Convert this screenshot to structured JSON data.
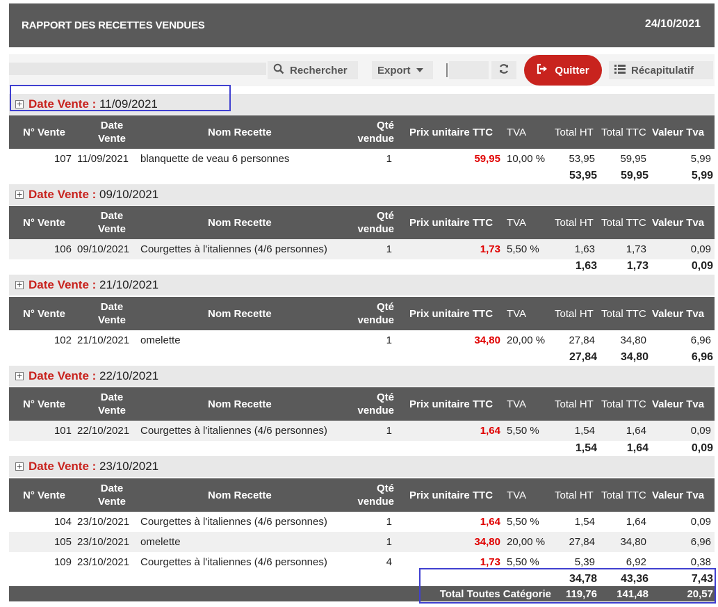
{
  "header": {
    "title": "RAPPORT DES RECETTES VENDUES",
    "date": "24/10/2021"
  },
  "toolbar": {
    "search_label": "Rechercher",
    "export_label": "Export",
    "quit_label": "Quitter",
    "summary_label": "Récapitulatif"
  },
  "icons": [
    "search-icon",
    "caret-down-icon",
    "refresh-icon",
    "sign-out-icon",
    "list-icon",
    "expand-icon"
  ],
  "colors": {
    "header_bg": "#5a5a5a",
    "accent": "#c8231e",
    "price": "#e00000",
    "highlight": "#4040d0"
  },
  "columns": [
    "N° Vente",
    "Date Vente",
    "Nom Recette",
    "Qté vendue",
    "Prix unitaire TTC",
    "TVA",
    "Total HT",
    "Total TTC",
    "Valeur Tva"
  ],
  "group_label": "Date Vente :",
  "groups": [
    {
      "date": "11/09/2021",
      "rows": [
        {
          "num": "107",
          "date": "11/09/2021",
          "name": "blanquette de veau 6 personnes",
          "qty": "1",
          "price": "59,95",
          "tva": "10,00 %",
          "ht": "53,95",
          "ttc": "59,95",
          "vtva": "5,99"
        }
      ],
      "total": {
        "ht": "53,95",
        "ttc": "59,95",
        "vtva": "5,99"
      }
    },
    {
      "date": "09/10/2021",
      "rows": [
        {
          "num": "106",
          "date": "09/10/2021",
          "name": "Courgettes à l'italiennes (4/6 personnes)",
          "qty": "1",
          "price": "1,73",
          "tva": "5,50 %",
          "ht": "1,63",
          "ttc": "1,73",
          "vtva": "0,09"
        }
      ],
      "total": {
        "ht": "1,63",
        "ttc": "1,73",
        "vtva": "0,09"
      }
    },
    {
      "date": "21/10/2021",
      "rows": [
        {
          "num": "102",
          "date": "21/10/2021",
          "name": "omelette",
          "qty": "1",
          "price": "34,80",
          "tva": "20,00 %",
          "ht": "27,84",
          "ttc": "34,80",
          "vtva": "6,96"
        }
      ],
      "total": {
        "ht": "27,84",
        "ttc": "34,80",
        "vtva": "6,96"
      }
    },
    {
      "date": "22/10/2021",
      "rows": [
        {
          "num": "101",
          "date": "22/10/2021",
          "name": "Courgettes à l'italiennes (4/6 personnes)",
          "qty": "1",
          "price": "1,64",
          "tva": "5,50 %",
          "ht": "1,54",
          "ttc": "1,64",
          "vtva": "0,09"
        }
      ],
      "total": {
        "ht": "1,54",
        "ttc": "1,64",
        "vtva": "0,09"
      }
    },
    {
      "date": "23/10/2021",
      "rows": [
        {
          "num": "104",
          "date": "23/10/2021",
          "name": "Courgettes à l'italiennes (4/6 personnes)",
          "qty": "1",
          "price": "1,64",
          "tva": "5,50 %",
          "ht": "1,54",
          "ttc": "1,64",
          "vtva": "0,09"
        },
        {
          "num": "105",
          "date": "23/10/2021",
          "name": "omelette",
          "qty": "1",
          "price": "34,80",
          "tva": "20,00 %",
          "ht": "27,84",
          "ttc": "34,80",
          "vtva": "6,96"
        },
        {
          "num": "109",
          "date": "23/10/2021",
          "name": "Courgettes à l'italiennes (4/6 personnes)",
          "qty": "4",
          "price": "1,73",
          "tva": "5,50 %",
          "ht": "5,39",
          "ttc": "6,92",
          "vtva": "0,38"
        }
      ],
      "total": {
        "ht": "34,78",
        "ttc": "43,36",
        "vtva": "7,43"
      }
    }
  ],
  "grand_total": {
    "label": "Total Toutes Catégorie",
    "ht": "119,76",
    "ttc": "141,48",
    "vtva": "20,57"
  }
}
